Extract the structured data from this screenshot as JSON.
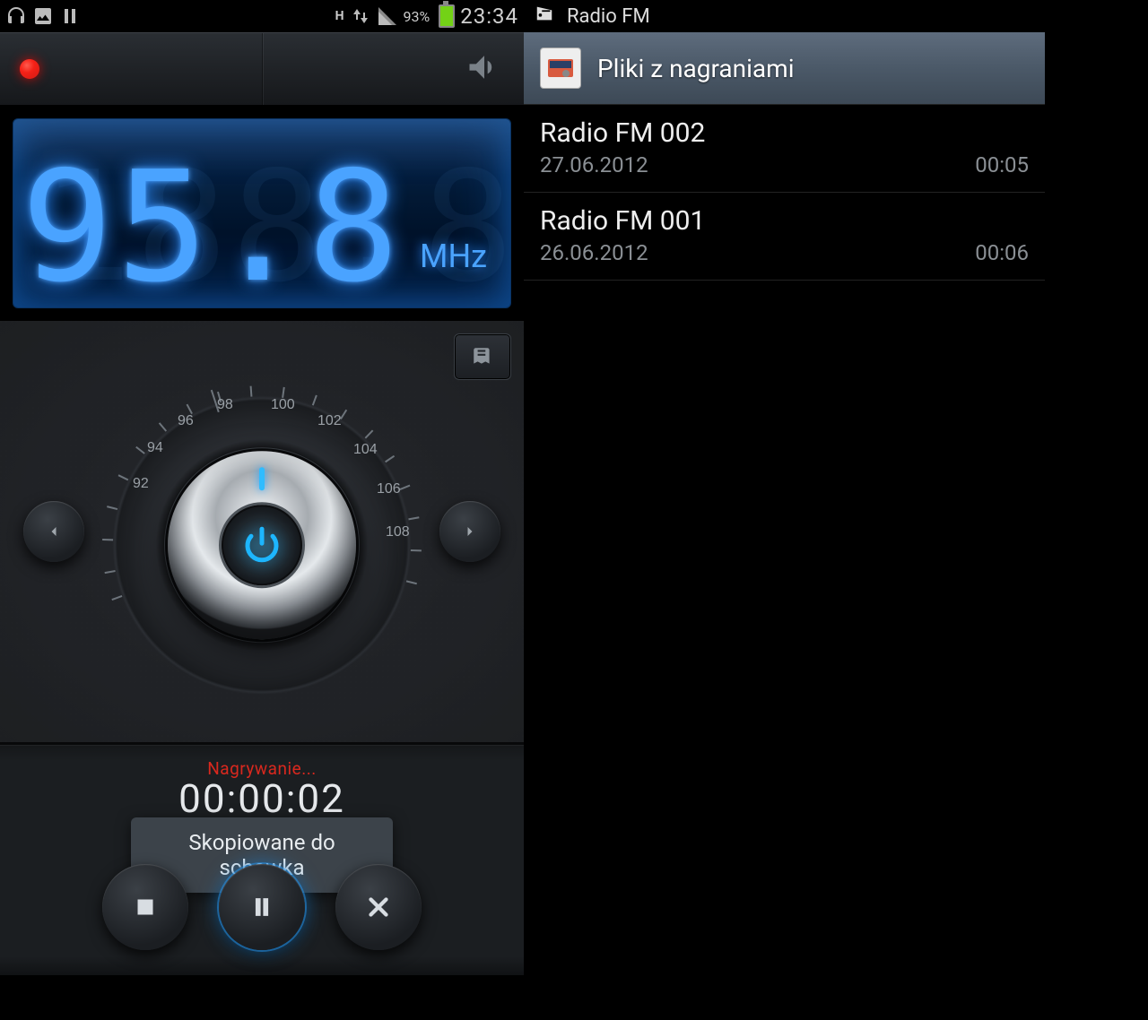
{
  "statusbar": {
    "battery_pct": "93%",
    "clock": "23:34",
    "net_label": "H"
  },
  "radio": {
    "ghost": "88.8",
    "frequency": "95.8",
    "unit": "MHz",
    "scale_labels": [
      "92",
      "94",
      "96",
      "98",
      "100",
      "102",
      "104",
      "106",
      "108"
    ]
  },
  "recorder": {
    "status": "Nagrywanie...",
    "elapsed": "00:00:02"
  },
  "toast": "Skopiowane do schowka",
  "right": {
    "app_title": "Radio FM",
    "header": "Pliki z nagraniami",
    "items": [
      {
        "title": "Radio FM 002",
        "date": "27.06.2012",
        "duration": "00:05"
      },
      {
        "title": "Radio FM 001",
        "date": "26.06.2012",
        "duration": "00:06"
      }
    ]
  }
}
